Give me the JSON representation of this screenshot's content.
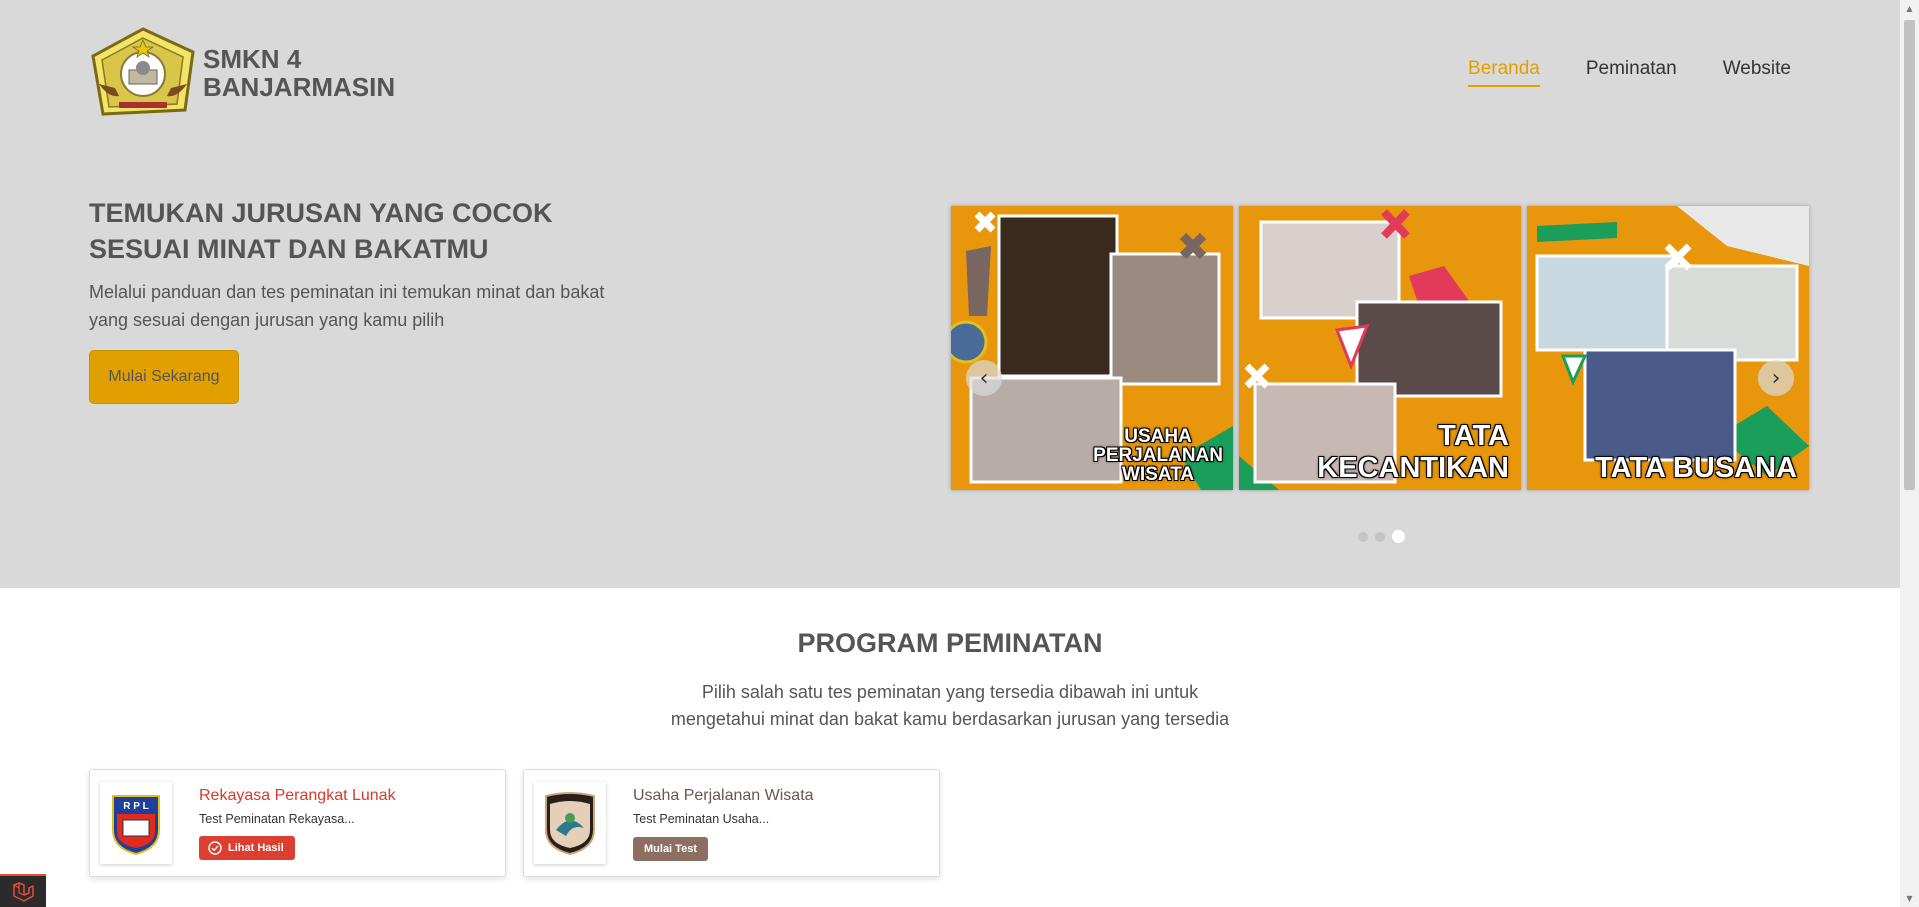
{
  "header": {
    "logo_line1": "SMKN 4",
    "logo_line2": "BANJARMASIN",
    "nav": [
      {
        "label": "Beranda",
        "active": true
      },
      {
        "label": "Peminatan",
        "active": false
      },
      {
        "label": "Website",
        "active": false
      }
    ]
  },
  "hero": {
    "title": "TEMUKAN JURUSAN YANG COCOK SESUAI MINAT DAN BAKATMU",
    "description": "Melalui panduan dan tes peminatan ini temukan minat dan bakat yang sesuai dengan jurusan yang kamu pilih",
    "cta_label": "Mulai Sekarang"
  },
  "carousel": {
    "slides": [
      {
        "caption_lines": [
          "USAHA",
          "PERJALANAN",
          "WISATA"
        ]
      },
      {
        "caption_lines": [
          "TATA",
          "KECANTIKAN"
        ]
      },
      {
        "caption_lines": [
          "TATA BUSANA"
        ]
      }
    ],
    "active_index": 2,
    "dot_count": 3
  },
  "program": {
    "title": "PROGRAM PEMINATAN",
    "desc_line1": "Pilih salah satu tes peminatan yang tersedia dibawah ini untuk",
    "desc_line2": "mengetahui minat dan bakat kamu berdasarkan jurusan yang tersedia",
    "cards": [
      {
        "title": "Rekayasa Perangkat Lunak",
        "subtitle": "Test Peminatan Rekayasa...",
        "button": "Lihat Hasil",
        "logo_text": "R P L"
      },
      {
        "title": "Usaha Perjalanan Wisata",
        "subtitle": "Test Peminatan Usaha...",
        "button": "Mulai Test"
      }
    ]
  },
  "colors": {
    "accent": "#e2a000",
    "hero_bg": "#d9d9d9",
    "danger": "#dc3f30",
    "brown": "#8d6e63"
  },
  "icons": {
    "prev": "chevron-left-icon",
    "next": "chevron-right-icon",
    "check": "check-circle-icon"
  }
}
